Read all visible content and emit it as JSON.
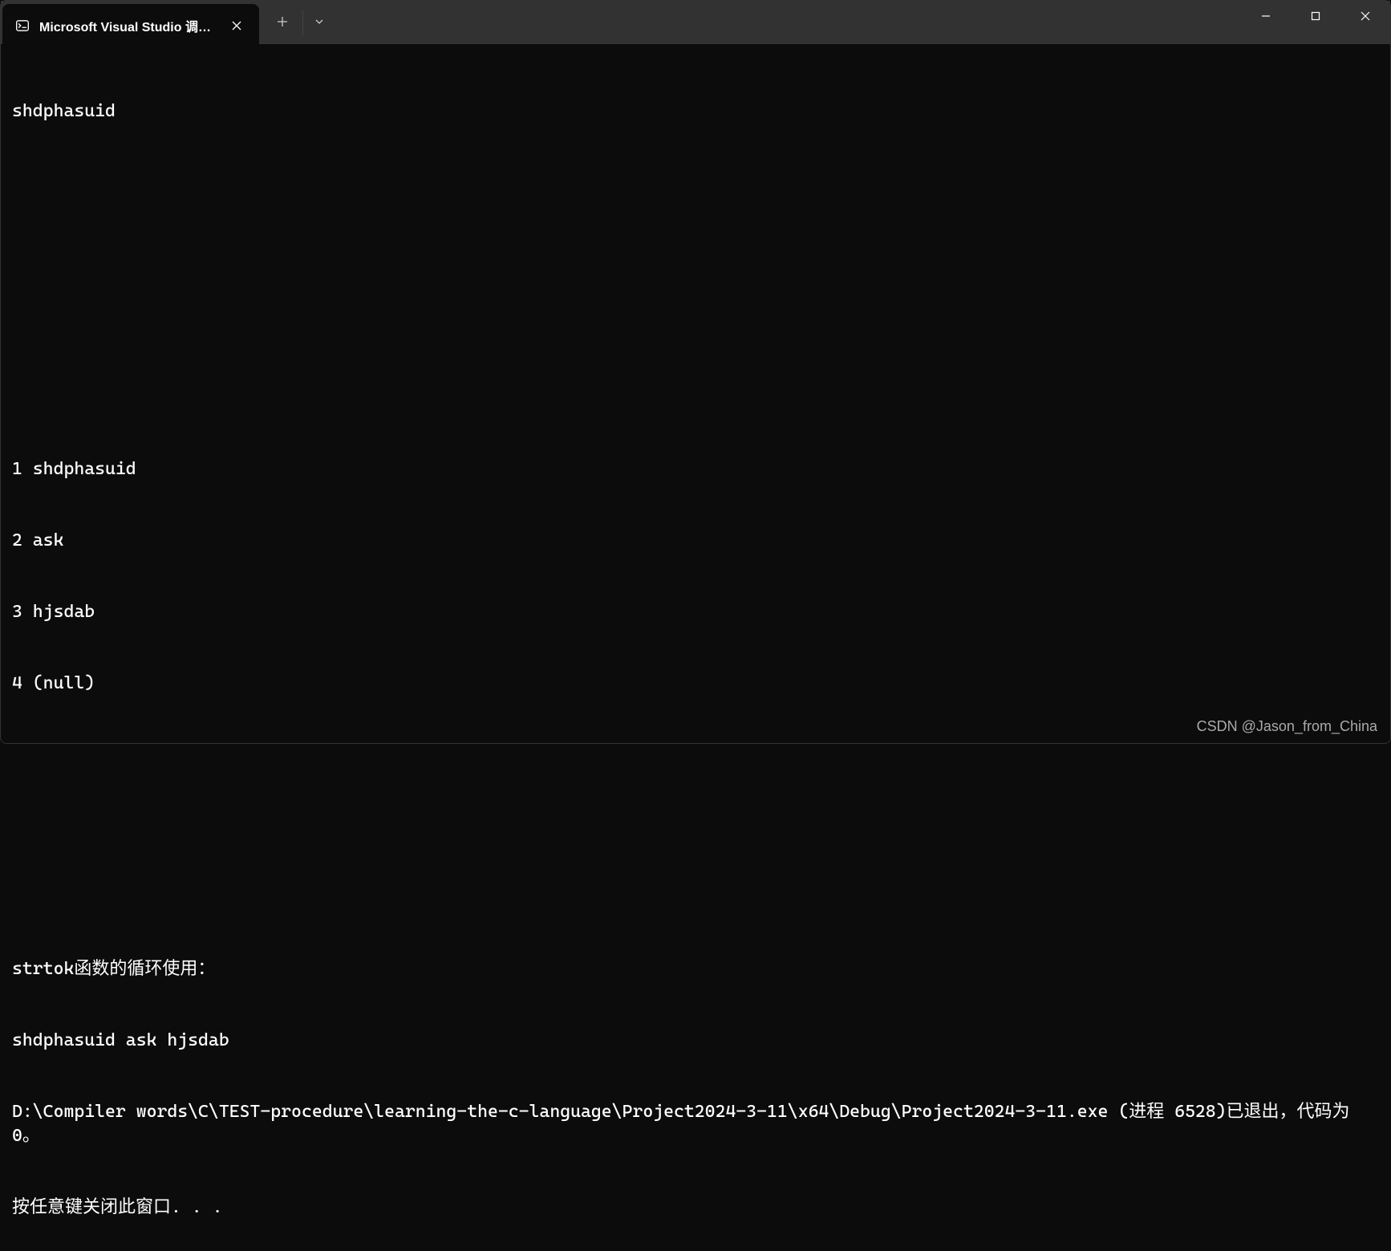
{
  "titlebar": {
    "tab": {
      "title": "Microsoft Visual Studio 调试控"
    }
  },
  "terminal": {
    "lines": [
      "shdphasuid",
      "",
      "",
      "",
      "",
      "1 shdphasuid",
      "2 ask",
      "3 hjsdab",
      "4 (null)",
      "",
      "",
      "",
      "strtok函数的循环使用：",
      "shdphasuid ask hjsdab",
      "D:\\Compiler words\\C\\TEST-procedure\\learning-the-c-language\\Project2024-3-11\\x64\\Debug\\Project2024-3-11.exe (进程 6528)已退出，代码为 0。",
      "按任意键关闭此窗口. . ."
    ]
  },
  "watermark": "CSDN @Jason_from_China"
}
